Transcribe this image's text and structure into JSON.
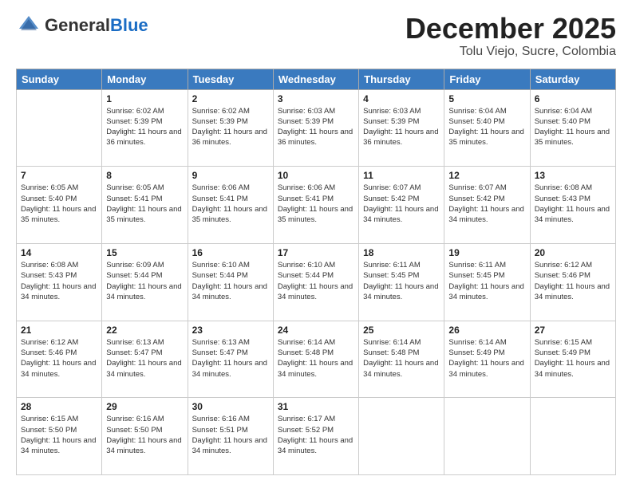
{
  "header": {
    "logo_general": "General",
    "logo_blue": "Blue",
    "month_title": "December 2025",
    "location": "Tolu Viejo, Sucre, Colombia"
  },
  "weekdays": [
    "Sunday",
    "Monday",
    "Tuesday",
    "Wednesday",
    "Thursday",
    "Friday",
    "Saturday"
  ],
  "weeks": [
    [
      {
        "day": "",
        "sunrise": "",
        "sunset": "",
        "daylight": ""
      },
      {
        "day": "1",
        "sunrise": "Sunrise: 6:02 AM",
        "sunset": "Sunset: 5:39 PM",
        "daylight": "Daylight: 11 hours and 36 minutes."
      },
      {
        "day": "2",
        "sunrise": "Sunrise: 6:02 AM",
        "sunset": "Sunset: 5:39 PM",
        "daylight": "Daylight: 11 hours and 36 minutes."
      },
      {
        "day": "3",
        "sunrise": "Sunrise: 6:03 AM",
        "sunset": "Sunset: 5:39 PM",
        "daylight": "Daylight: 11 hours and 36 minutes."
      },
      {
        "day": "4",
        "sunrise": "Sunrise: 6:03 AM",
        "sunset": "Sunset: 5:39 PM",
        "daylight": "Daylight: 11 hours and 36 minutes."
      },
      {
        "day": "5",
        "sunrise": "Sunrise: 6:04 AM",
        "sunset": "Sunset: 5:40 PM",
        "daylight": "Daylight: 11 hours and 35 minutes."
      },
      {
        "day": "6",
        "sunrise": "Sunrise: 6:04 AM",
        "sunset": "Sunset: 5:40 PM",
        "daylight": "Daylight: 11 hours and 35 minutes."
      }
    ],
    [
      {
        "day": "7",
        "sunrise": "Sunrise: 6:05 AM",
        "sunset": "Sunset: 5:40 PM",
        "daylight": "Daylight: 11 hours and 35 minutes."
      },
      {
        "day": "8",
        "sunrise": "Sunrise: 6:05 AM",
        "sunset": "Sunset: 5:41 PM",
        "daylight": "Daylight: 11 hours and 35 minutes."
      },
      {
        "day": "9",
        "sunrise": "Sunrise: 6:06 AM",
        "sunset": "Sunset: 5:41 PM",
        "daylight": "Daylight: 11 hours and 35 minutes."
      },
      {
        "day": "10",
        "sunrise": "Sunrise: 6:06 AM",
        "sunset": "Sunset: 5:41 PM",
        "daylight": "Daylight: 11 hours and 35 minutes."
      },
      {
        "day": "11",
        "sunrise": "Sunrise: 6:07 AM",
        "sunset": "Sunset: 5:42 PM",
        "daylight": "Daylight: 11 hours and 34 minutes."
      },
      {
        "day": "12",
        "sunrise": "Sunrise: 6:07 AM",
        "sunset": "Sunset: 5:42 PM",
        "daylight": "Daylight: 11 hours and 34 minutes."
      },
      {
        "day": "13",
        "sunrise": "Sunrise: 6:08 AM",
        "sunset": "Sunset: 5:43 PM",
        "daylight": "Daylight: 11 hours and 34 minutes."
      }
    ],
    [
      {
        "day": "14",
        "sunrise": "Sunrise: 6:08 AM",
        "sunset": "Sunset: 5:43 PM",
        "daylight": "Daylight: 11 hours and 34 minutes."
      },
      {
        "day": "15",
        "sunrise": "Sunrise: 6:09 AM",
        "sunset": "Sunset: 5:44 PM",
        "daylight": "Daylight: 11 hours and 34 minutes."
      },
      {
        "day": "16",
        "sunrise": "Sunrise: 6:10 AM",
        "sunset": "Sunset: 5:44 PM",
        "daylight": "Daylight: 11 hours and 34 minutes."
      },
      {
        "day": "17",
        "sunrise": "Sunrise: 6:10 AM",
        "sunset": "Sunset: 5:44 PM",
        "daylight": "Daylight: 11 hours and 34 minutes."
      },
      {
        "day": "18",
        "sunrise": "Sunrise: 6:11 AM",
        "sunset": "Sunset: 5:45 PM",
        "daylight": "Daylight: 11 hours and 34 minutes."
      },
      {
        "day": "19",
        "sunrise": "Sunrise: 6:11 AM",
        "sunset": "Sunset: 5:45 PM",
        "daylight": "Daylight: 11 hours and 34 minutes."
      },
      {
        "day": "20",
        "sunrise": "Sunrise: 6:12 AM",
        "sunset": "Sunset: 5:46 PM",
        "daylight": "Daylight: 11 hours and 34 minutes."
      }
    ],
    [
      {
        "day": "21",
        "sunrise": "Sunrise: 6:12 AM",
        "sunset": "Sunset: 5:46 PM",
        "daylight": "Daylight: 11 hours and 34 minutes."
      },
      {
        "day": "22",
        "sunrise": "Sunrise: 6:13 AM",
        "sunset": "Sunset: 5:47 PM",
        "daylight": "Daylight: 11 hours and 34 minutes."
      },
      {
        "day": "23",
        "sunrise": "Sunrise: 6:13 AM",
        "sunset": "Sunset: 5:47 PM",
        "daylight": "Daylight: 11 hours and 34 minutes."
      },
      {
        "day": "24",
        "sunrise": "Sunrise: 6:14 AM",
        "sunset": "Sunset: 5:48 PM",
        "daylight": "Daylight: 11 hours and 34 minutes."
      },
      {
        "day": "25",
        "sunrise": "Sunrise: 6:14 AM",
        "sunset": "Sunset: 5:48 PM",
        "daylight": "Daylight: 11 hours and 34 minutes."
      },
      {
        "day": "26",
        "sunrise": "Sunrise: 6:14 AM",
        "sunset": "Sunset: 5:49 PM",
        "daylight": "Daylight: 11 hours and 34 minutes."
      },
      {
        "day": "27",
        "sunrise": "Sunrise: 6:15 AM",
        "sunset": "Sunset: 5:49 PM",
        "daylight": "Daylight: 11 hours and 34 minutes."
      }
    ],
    [
      {
        "day": "28",
        "sunrise": "Sunrise: 6:15 AM",
        "sunset": "Sunset: 5:50 PM",
        "daylight": "Daylight: 11 hours and 34 minutes."
      },
      {
        "day": "29",
        "sunrise": "Sunrise: 6:16 AM",
        "sunset": "Sunset: 5:50 PM",
        "daylight": "Daylight: 11 hours and 34 minutes."
      },
      {
        "day": "30",
        "sunrise": "Sunrise: 6:16 AM",
        "sunset": "Sunset: 5:51 PM",
        "daylight": "Daylight: 11 hours and 34 minutes."
      },
      {
        "day": "31",
        "sunrise": "Sunrise: 6:17 AM",
        "sunset": "Sunset: 5:52 PM",
        "daylight": "Daylight: 11 hours and 34 minutes."
      },
      {
        "day": "",
        "sunrise": "",
        "sunset": "",
        "daylight": ""
      },
      {
        "day": "",
        "sunrise": "",
        "sunset": "",
        "daylight": ""
      },
      {
        "day": "",
        "sunrise": "",
        "sunset": "",
        "daylight": ""
      }
    ]
  ]
}
